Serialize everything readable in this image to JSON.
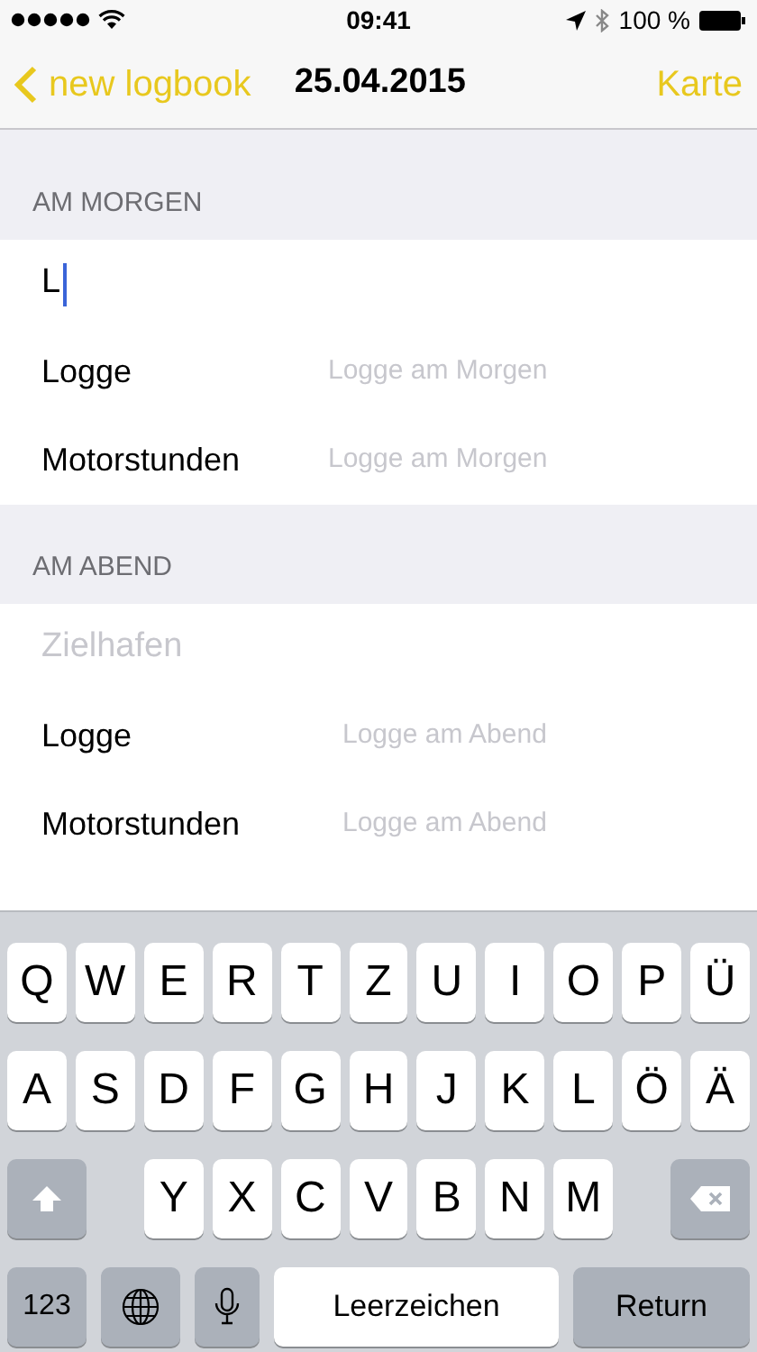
{
  "status_bar": {
    "time": "09:41",
    "battery": "100 %"
  },
  "nav": {
    "back": "new logbook",
    "title": "25.04.2015",
    "action": "Karte"
  },
  "sections": [
    {
      "header": "AM MORGEN",
      "rows": [
        {
          "kind": "text",
          "value": "L",
          "focused": true
        },
        {
          "kind": "labeled",
          "label": "Logge",
          "placeholder": "Logge am Morgen"
        },
        {
          "kind": "labeled",
          "label": "Motorstunden",
          "placeholder": "Logge am Morgen"
        }
      ]
    },
    {
      "header": "AM ABEND",
      "rows": [
        {
          "kind": "text",
          "placeholder": "Zielhafen",
          "focused": false
        },
        {
          "kind": "labeled",
          "label": "Logge",
          "placeholder": "Logge am Abend"
        },
        {
          "kind": "labeled",
          "label": "Motorstunden",
          "placeholder": "Logge am Abend"
        }
      ]
    }
  ],
  "keyboard": {
    "top_row": [
      "Q",
      "W",
      "E",
      "R",
      "T",
      "Z",
      "U",
      "I",
      "O",
      "P",
      "Ü"
    ],
    "middle_row": [
      "A",
      "S",
      "D",
      "F",
      "G",
      "H",
      "J",
      "K",
      "L",
      "Ö",
      "Ä"
    ],
    "bottom_row": [
      "Y",
      "X",
      "C",
      "V",
      "B",
      "N",
      "M"
    ],
    "numbers": "123",
    "space": "Leerzeichen",
    "return": "Return"
  }
}
